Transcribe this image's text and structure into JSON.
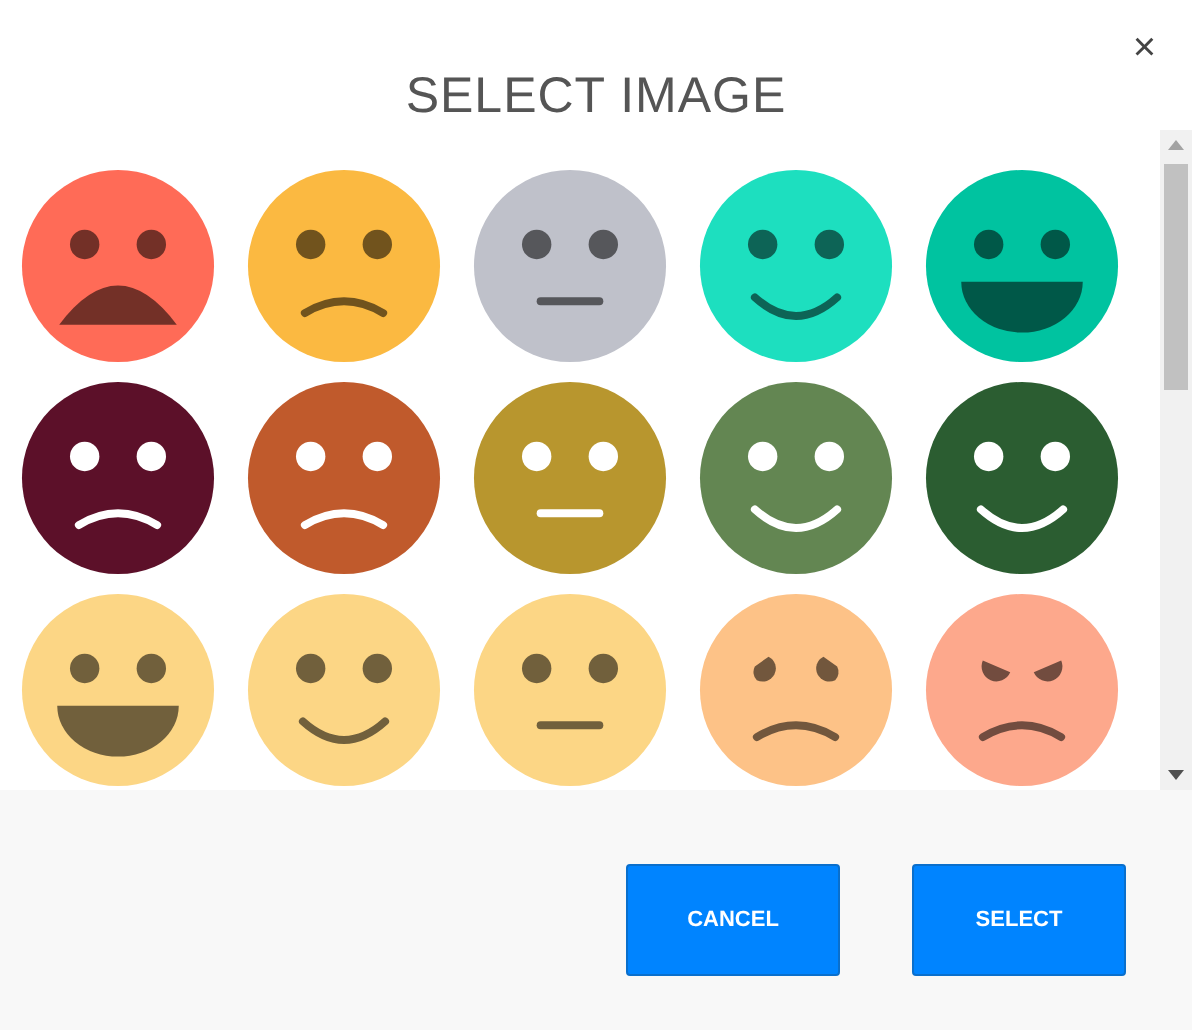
{
  "dialog": {
    "title": "SELECT IMAGE",
    "close": "×"
  },
  "faces": [
    {
      "kind": "open-frown",
      "color": "#ff6b57",
      "light_features": false
    },
    {
      "kind": "frown",
      "color": "#fbb941",
      "light_features": false
    },
    {
      "kind": "neutral",
      "color": "#bfc1ca",
      "light_features": false
    },
    {
      "kind": "smile",
      "color": "#1ddfbf",
      "light_features": false
    },
    {
      "kind": "grin",
      "color": "#00c3a0",
      "light_features": false
    },
    {
      "kind": "frown",
      "color": "#5c1029",
      "light_features": true
    },
    {
      "kind": "frown",
      "color": "#c05a2c",
      "light_features": true
    },
    {
      "kind": "neutral",
      "color": "#b8962e",
      "light_features": true
    },
    {
      "kind": "smile",
      "color": "#638652",
      "light_features": true
    },
    {
      "kind": "smile",
      "color": "#2b5d31",
      "light_features": true
    },
    {
      "kind": "grin",
      "color": "#fcd685",
      "light_features": false
    },
    {
      "kind": "smile",
      "color": "#fcd685",
      "light_features": false
    },
    {
      "kind": "neutral",
      "color": "#fcd685",
      "light_features": false
    },
    {
      "kind": "worried",
      "color": "#fdc287",
      "light_features": false
    },
    {
      "kind": "angry",
      "color": "#fda88c",
      "light_features": false
    }
  ],
  "buttons": [
    "CANCEL",
    "SELECT"
  ]
}
